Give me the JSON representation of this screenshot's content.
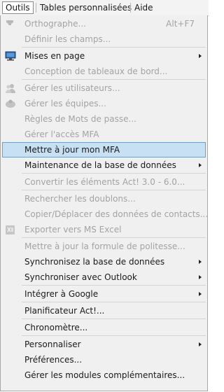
{
  "menubar": {
    "items": [
      "Outils",
      "Tables personnalisées",
      "Aide"
    ]
  },
  "menu": {
    "items": {
      "orthographe": "Orthographe...",
      "orthographe_shortcut": "Alt+F7",
      "definir_champs": "Définir les champs...",
      "mises_en_page": "Mises en page",
      "conception_tableaux": "Conception de tableaux de bord...",
      "gerer_utilisateurs": "Gérer les utilisateurs...",
      "gerer_equipes": "Gérer les équipes...",
      "regles_mots_passe": "Règles de Mots de passe...",
      "gerer_acces_mfa": "Gérer l'accès MFA",
      "mettre_a_jour_mfa": "Mettre à jour mon MFA",
      "maintenance_bdd": "Maintenance de la base de données",
      "convertir_elements": "Convertir les éléments Act! 3.0 - 6.0...",
      "rechercher_doublons": "Rechercher les doublons...",
      "copier_deplacer": "Copier/Déplacer des données de contacts...",
      "exporter_excel": "Exporter vers MS Excel",
      "mettre_a_jour_politesse": "Mettre à jour la formule de politesse...",
      "synchroniser_bdd": "Synchronisez la base de données",
      "synchroniser_outlook": "Synchroniser avec Outlook",
      "integrer_google": "Intégrer à Google",
      "planificateur": "Planificateur Act!...",
      "chronometre": "Chronomètre...",
      "personnaliser": "Personnaliser",
      "preferences": "Préférences...",
      "gerer_modules": "Gérer les modules complémentaires..."
    }
  },
  "colors": {
    "highlight_fill": "#c7e0f4",
    "highlight_border": "#5fa6d6",
    "disabled_text": "#a3a3a3"
  }
}
